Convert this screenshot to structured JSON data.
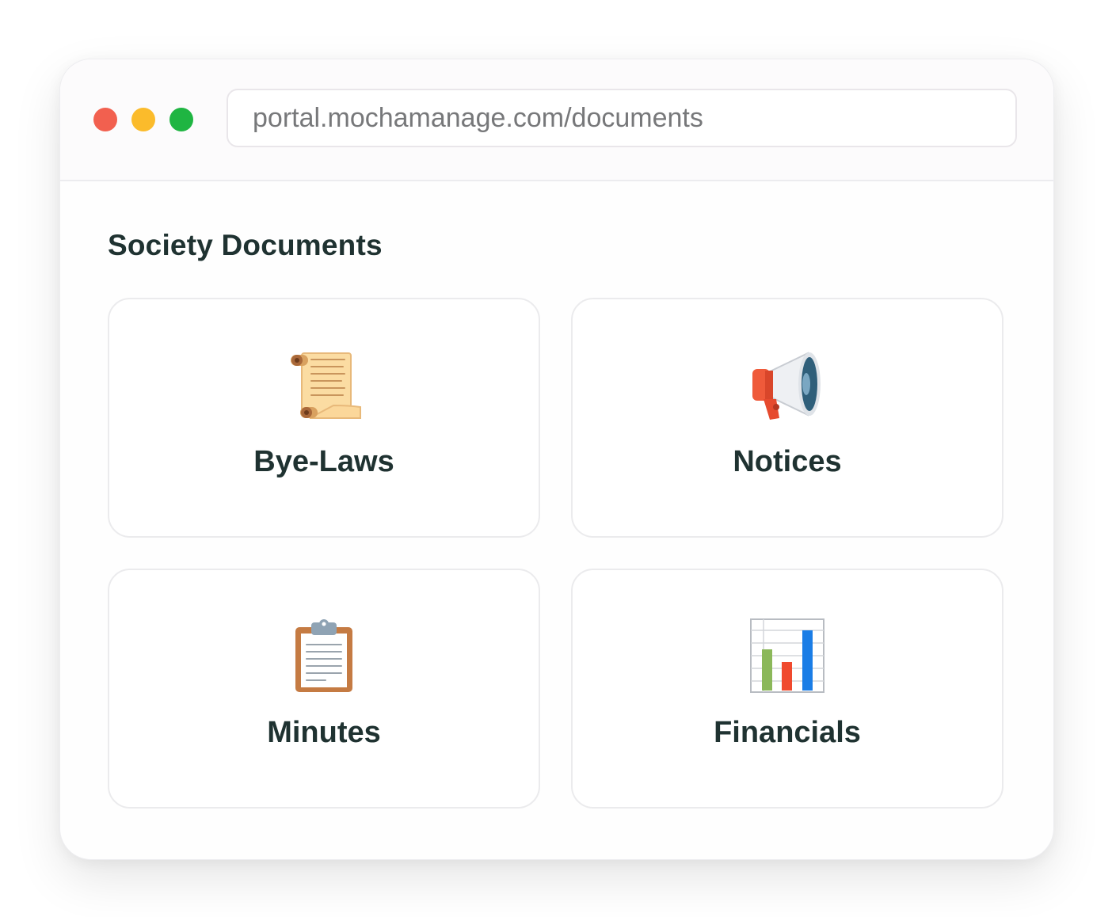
{
  "browser": {
    "url": "portal.mochamanage.com/documents",
    "controls": [
      {
        "name": "close",
        "color": "#f2604f"
      },
      {
        "name": "minimize",
        "color": "#fbbb2b"
      },
      {
        "name": "maximize",
        "color": "#1fb542"
      }
    ]
  },
  "page": {
    "title": "Society Documents"
  },
  "cards": [
    {
      "label": "Bye-Laws",
      "icon": "scroll-icon"
    },
    {
      "label": "Notices",
      "icon": "megaphone-icon"
    },
    {
      "label": "Minutes",
      "icon": "clipboard-icon"
    },
    {
      "label": "Financials",
      "icon": "bar-chart-icon"
    }
  ],
  "colors": {
    "text": "#1f3231",
    "url_text": "#77787a",
    "card_border": "#ebebed"
  }
}
